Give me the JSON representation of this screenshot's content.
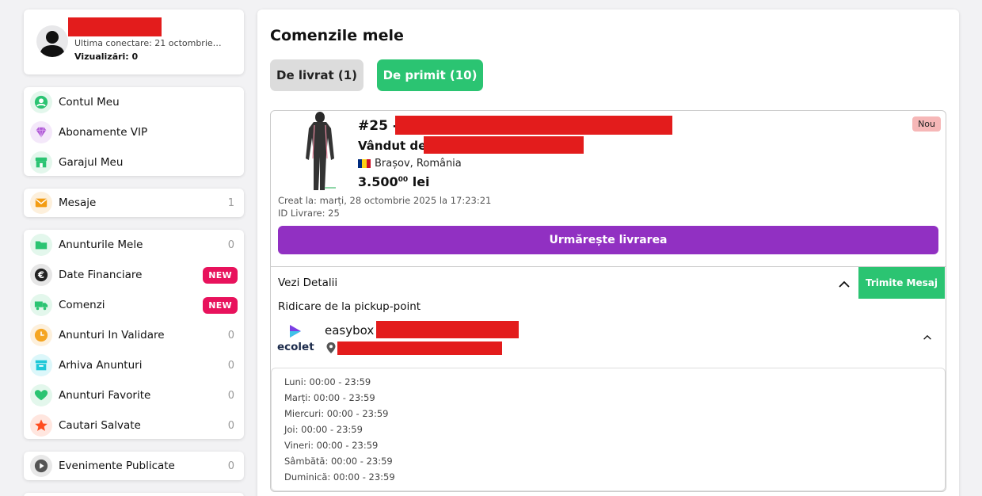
{
  "profile": {
    "last_login": "Ultima conectare: 21 octombrie…",
    "views": "Vizualizări: 0"
  },
  "menu_group1": [
    {
      "label": "Contul Meu",
      "icon": "user-icon",
      "color": "#2bc472"
    },
    {
      "label": "Abonamente VIP",
      "icon": "diamond-icon",
      "color": "#b05bd6"
    },
    {
      "label": "Garajul Meu",
      "icon": "store-icon",
      "color": "#2bc472"
    }
  ],
  "menu_messages": {
    "label": "Mesaje",
    "count": "1",
    "icon": "envelope-icon",
    "color": "#f39c12"
  },
  "menu_group2": [
    {
      "label": "Anunturile Mele",
      "count": "0",
      "icon": "folder-icon",
      "color": "#2bc472"
    },
    {
      "label": "Date Financiare",
      "badge": "NEW",
      "icon": "euro-icon",
      "color": "#222222"
    },
    {
      "label": "Comenzi",
      "badge": "NEW",
      "icon": "truck-icon",
      "color": "#2bc472"
    },
    {
      "label": "Anunturi In Validare",
      "count": "0",
      "icon": "clock-icon",
      "color": "#f5a623"
    },
    {
      "label": "Arhiva Anunturi",
      "count": "0",
      "icon": "archive-icon",
      "color": "#1ec8d8"
    },
    {
      "label": "Anunturi Favorite",
      "count": "0",
      "icon": "heart-icon",
      "color": "#2bc472"
    },
    {
      "label": "Cautari Salvate",
      "count": "0",
      "icon": "star-icon",
      "color": "#ff4d1f"
    }
  ],
  "menu_events": {
    "label": "Evenimente Publicate",
    "count": "0",
    "icon": "play-icon",
    "color": "#555555"
  },
  "main": {
    "title": "Comenzile mele",
    "tab_deliver": "De livrat (1)",
    "tab_receive": "De primit (10)"
  },
  "order": {
    "number": "#25 -",
    "seller_label": "Vândut de:",
    "location": "Brașov, România",
    "price_int": "3.500",
    "price_dec": "00",
    "currency": "lei",
    "badge": "Nou",
    "created": "Creat la: marți, 28 octombrie 2025 la 17:23:21",
    "delivery_id": "ID Livrare: 25",
    "track_button": "Urmărește livrarea",
    "details_label": "Vezi Detalii",
    "send_message": "Trimite Mesaj",
    "pickup_label": "Ridicare de la pickup-point",
    "courier_logo": "ecolet",
    "locker_name": "easybox",
    "schedule": [
      "Luni: 00:00 - 23:59",
      "Marți: 00:00 - 23:59",
      "Miercuri: 00:00 - 23:59",
      "Joi: 00:00 - 23:59",
      "Vineri: 00:00 - 23:59",
      "Sâmbătă: 00:00 - 23:59",
      "Duminică: 00:00 - 23:59"
    ]
  },
  "colors": {
    "accent_green": "#2bc472",
    "accent_purple": "#9130c2",
    "badge_red": "#e8125c",
    "redaction": "#e31c1c"
  }
}
